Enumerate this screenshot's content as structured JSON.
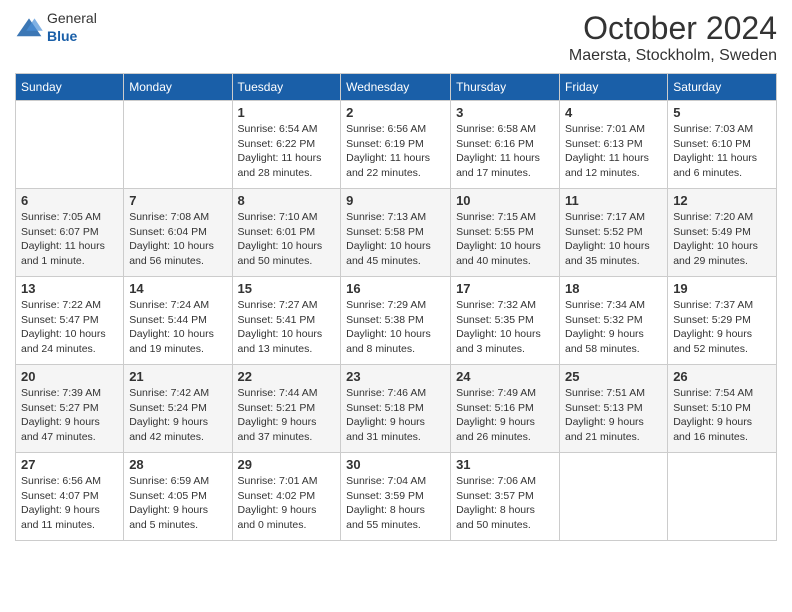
{
  "logo": {
    "general": "General",
    "blue": "Blue"
  },
  "title": {
    "month": "October 2024",
    "location": "Maersta, Stockholm, Sweden"
  },
  "headers": [
    "Sunday",
    "Monday",
    "Tuesday",
    "Wednesday",
    "Thursday",
    "Friday",
    "Saturday"
  ],
  "weeks": [
    [
      {
        "day": "",
        "info": ""
      },
      {
        "day": "",
        "info": ""
      },
      {
        "day": "1",
        "info": "Sunrise: 6:54 AM\nSunset: 6:22 PM\nDaylight: 11 hours and 28 minutes."
      },
      {
        "day": "2",
        "info": "Sunrise: 6:56 AM\nSunset: 6:19 PM\nDaylight: 11 hours and 22 minutes."
      },
      {
        "day": "3",
        "info": "Sunrise: 6:58 AM\nSunset: 6:16 PM\nDaylight: 11 hours and 17 minutes."
      },
      {
        "day": "4",
        "info": "Sunrise: 7:01 AM\nSunset: 6:13 PM\nDaylight: 11 hours and 12 minutes."
      },
      {
        "day": "5",
        "info": "Sunrise: 7:03 AM\nSunset: 6:10 PM\nDaylight: 11 hours and 6 minutes."
      }
    ],
    [
      {
        "day": "6",
        "info": "Sunrise: 7:05 AM\nSunset: 6:07 PM\nDaylight: 11 hours and 1 minute."
      },
      {
        "day": "7",
        "info": "Sunrise: 7:08 AM\nSunset: 6:04 PM\nDaylight: 10 hours and 56 minutes."
      },
      {
        "day": "8",
        "info": "Sunrise: 7:10 AM\nSunset: 6:01 PM\nDaylight: 10 hours and 50 minutes."
      },
      {
        "day": "9",
        "info": "Sunrise: 7:13 AM\nSunset: 5:58 PM\nDaylight: 10 hours and 45 minutes."
      },
      {
        "day": "10",
        "info": "Sunrise: 7:15 AM\nSunset: 5:55 PM\nDaylight: 10 hours and 40 minutes."
      },
      {
        "day": "11",
        "info": "Sunrise: 7:17 AM\nSunset: 5:52 PM\nDaylight: 10 hours and 35 minutes."
      },
      {
        "day": "12",
        "info": "Sunrise: 7:20 AM\nSunset: 5:49 PM\nDaylight: 10 hours and 29 minutes."
      }
    ],
    [
      {
        "day": "13",
        "info": "Sunrise: 7:22 AM\nSunset: 5:47 PM\nDaylight: 10 hours and 24 minutes."
      },
      {
        "day": "14",
        "info": "Sunrise: 7:24 AM\nSunset: 5:44 PM\nDaylight: 10 hours and 19 minutes."
      },
      {
        "day": "15",
        "info": "Sunrise: 7:27 AM\nSunset: 5:41 PM\nDaylight: 10 hours and 13 minutes."
      },
      {
        "day": "16",
        "info": "Sunrise: 7:29 AM\nSunset: 5:38 PM\nDaylight: 10 hours and 8 minutes."
      },
      {
        "day": "17",
        "info": "Sunrise: 7:32 AM\nSunset: 5:35 PM\nDaylight: 10 hours and 3 minutes."
      },
      {
        "day": "18",
        "info": "Sunrise: 7:34 AM\nSunset: 5:32 PM\nDaylight: 9 hours and 58 minutes."
      },
      {
        "day": "19",
        "info": "Sunrise: 7:37 AM\nSunset: 5:29 PM\nDaylight: 9 hours and 52 minutes."
      }
    ],
    [
      {
        "day": "20",
        "info": "Sunrise: 7:39 AM\nSunset: 5:27 PM\nDaylight: 9 hours and 47 minutes."
      },
      {
        "day": "21",
        "info": "Sunrise: 7:42 AM\nSunset: 5:24 PM\nDaylight: 9 hours and 42 minutes."
      },
      {
        "day": "22",
        "info": "Sunrise: 7:44 AM\nSunset: 5:21 PM\nDaylight: 9 hours and 37 minutes."
      },
      {
        "day": "23",
        "info": "Sunrise: 7:46 AM\nSunset: 5:18 PM\nDaylight: 9 hours and 31 minutes."
      },
      {
        "day": "24",
        "info": "Sunrise: 7:49 AM\nSunset: 5:16 PM\nDaylight: 9 hours and 26 minutes."
      },
      {
        "day": "25",
        "info": "Sunrise: 7:51 AM\nSunset: 5:13 PM\nDaylight: 9 hours and 21 minutes."
      },
      {
        "day": "26",
        "info": "Sunrise: 7:54 AM\nSunset: 5:10 PM\nDaylight: 9 hours and 16 minutes."
      }
    ],
    [
      {
        "day": "27",
        "info": "Sunrise: 6:56 AM\nSunset: 4:07 PM\nDaylight: 9 hours and 11 minutes."
      },
      {
        "day": "28",
        "info": "Sunrise: 6:59 AM\nSunset: 4:05 PM\nDaylight: 9 hours and 5 minutes."
      },
      {
        "day": "29",
        "info": "Sunrise: 7:01 AM\nSunset: 4:02 PM\nDaylight: 9 hours and 0 minutes."
      },
      {
        "day": "30",
        "info": "Sunrise: 7:04 AM\nSunset: 3:59 PM\nDaylight: 8 hours and 55 minutes."
      },
      {
        "day": "31",
        "info": "Sunrise: 7:06 AM\nSunset: 3:57 PM\nDaylight: 8 hours and 50 minutes."
      },
      {
        "day": "",
        "info": ""
      },
      {
        "day": "",
        "info": ""
      }
    ]
  ]
}
